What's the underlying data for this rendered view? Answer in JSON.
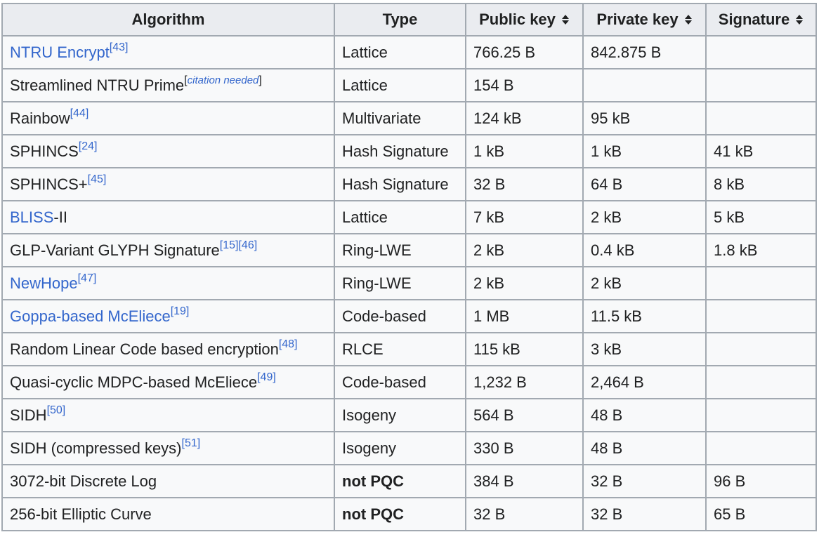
{
  "headers": {
    "algorithm": "Algorithm",
    "type": "Type",
    "public_key": "Public key",
    "private_key": "Private key",
    "signature": "Signature"
  },
  "rows": [
    {
      "name": "NTRU Encrypt",
      "ref": "[43]",
      "type": "Lattice",
      "pub": "766.25 B",
      "priv": "842.875 B",
      "sig": ""
    },
    {
      "name": "Streamlined NTRU Prime",
      "cn_open": "[",
      "cn_text": "citation needed",
      "cn_close": "]",
      "type": "Lattice",
      "pub": "154 B",
      "priv": "",
      "sig": ""
    },
    {
      "name": "Rainbow",
      "ref": "[44]",
      "type": "Multivariate",
      "pub": "124 kB",
      "priv": "95 kB",
      "sig": ""
    },
    {
      "name": "SPHINCS",
      "ref": "[24]",
      "type": "Hash Signature",
      "pub": "1 kB",
      "priv": "1 kB",
      "sig": "41 kB"
    },
    {
      "name": "SPHINCS+",
      "ref": "[45]",
      "type": "Hash Signature",
      "pub": "32 B",
      "priv": "64 B",
      "sig": "8 kB"
    },
    {
      "name_link": "BLISS",
      "name_rest": "-II",
      "type": "Lattice",
      "pub": "7 kB",
      "priv": "2 kB",
      "sig": "5 kB"
    },
    {
      "name": "GLP-Variant GLYPH Signature",
      "ref": "[15][46]",
      "type": "Ring-LWE",
      "pub": "2 kB",
      "priv": "0.4 kB",
      "sig": "1.8 kB"
    },
    {
      "name": "NewHope",
      "ref": "[47]",
      "type": "Ring-LWE",
      "pub": "2 kB",
      "priv": "2 kB",
      "sig": ""
    },
    {
      "name": "Goppa-based McEliece",
      "ref": "[19]",
      "type": "Code-based",
      "pub": "1 MB",
      "priv": "11.5 kB",
      "sig": ""
    },
    {
      "name": "Random Linear Code based encryption",
      "ref": "[48]",
      "type": "RLCE",
      "pub": "115 kB",
      "priv": "3 kB",
      "sig": ""
    },
    {
      "name": "Quasi-cyclic MDPC-based McEliece",
      "ref": "[49]",
      "type": "Code-based",
      "pub": "1,232 B",
      "priv": "2,464 B",
      "sig": ""
    },
    {
      "name": "SIDH",
      "ref": "[50]",
      "type": "Isogeny",
      "pub": "564 B",
      "priv": "48 B",
      "sig": ""
    },
    {
      "name": "SIDH (compressed keys)",
      "ref": "[51]",
      "type": "Isogeny",
      "pub": "330 B",
      "priv": "48 B",
      "sig": ""
    },
    {
      "name": "3072-bit Discrete Log",
      "type": "not PQC",
      "pub": "384 B",
      "priv": "32 B",
      "sig": "96 B"
    },
    {
      "name": "256-bit Elliptic Curve",
      "type": "not PQC",
      "pub": "32 B",
      "priv": "32 B",
      "sig": "65 B"
    }
  ],
  "colors": {
    "link": "#3366cc",
    "text": "#202122",
    "border": "#a2a9b1",
    "header_bg": "#eaecf0"
  },
  "icons": {
    "sort": "sort-updown-icon"
  }
}
